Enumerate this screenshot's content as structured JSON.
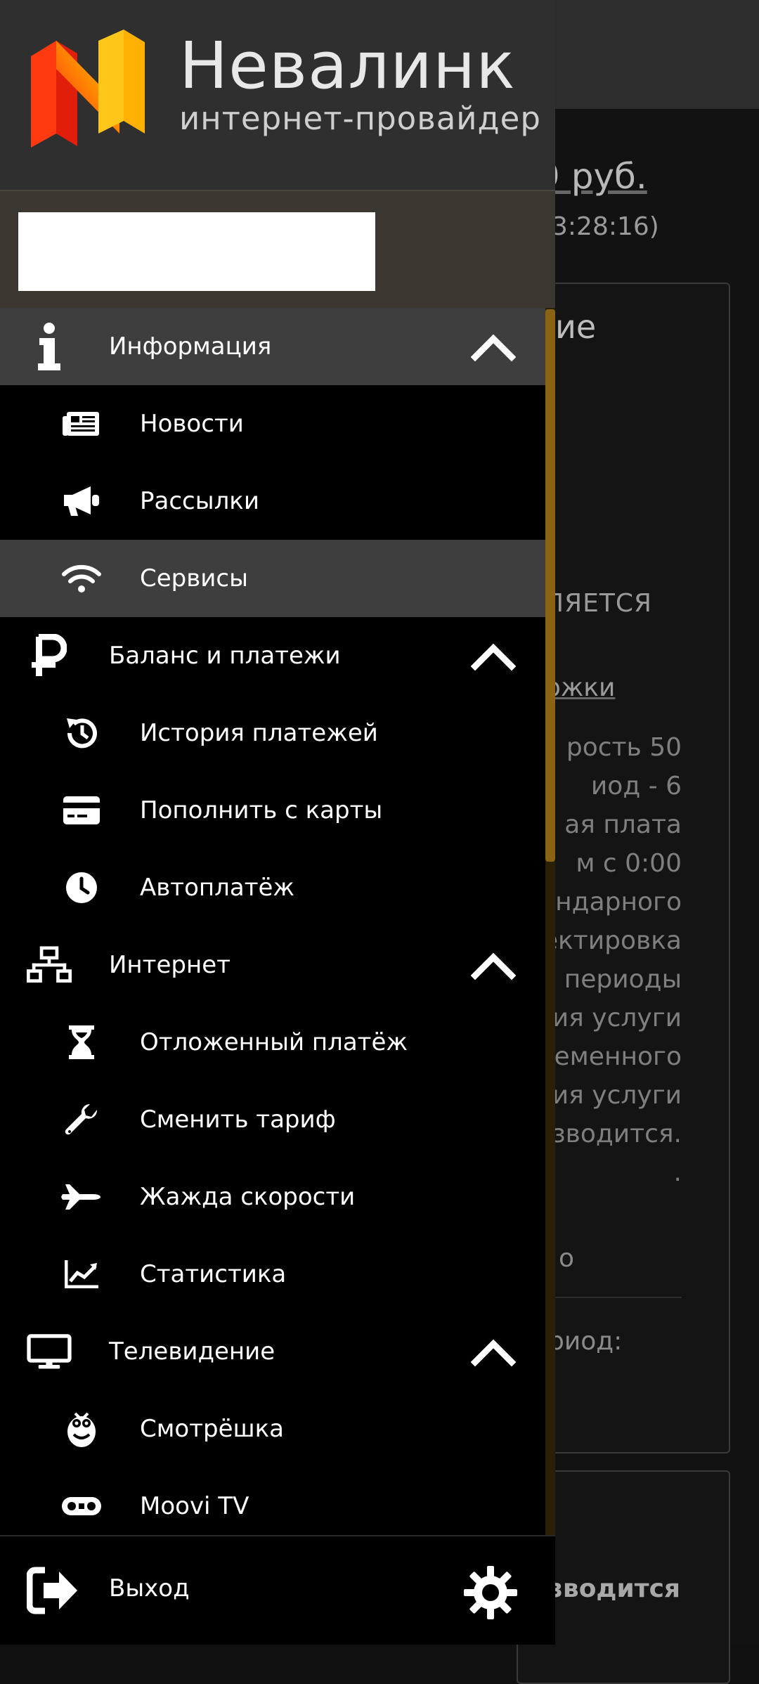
{
  "background": {
    "balance": "9 руб.",
    "time": "3:28:16)",
    "card_title": "ие",
    "status_upper": "ЛЯЕТСЯ",
    "link": "ржки",
    "paragraph": [
      "рость 50",
      "иод - 6",
      "ая плата",
      "м с 0:00",
      "ендарного",
      "ектировка",
      "периоды",
      "ия услуги",
      "еменного",
      "ия услуги",
      "зводится.",
      "."
    ],
    "small": "о",
    "period": "риод:",
    "bottom": "зводится"
  },
  "header": {
    "brand": "Невалинк",
    "tagline": "интернет-провайдер",
    "logo_colors": [
      "#ff2a1a",
      "#ff8c00",
      "#ffd21a"
    ]
  },
  "menu": [
    {
      "type": "section",
      "label": "Информация",
      "icon": "info-icon",
      "active": true,
      "expanded": true
    },
    {
      "type": "sub",
      "label": "Новости",
      "icon": "newspaper-icon"
    },
    {
      "type": "sub",
      "label": "Рассылки",
      "icon": "megaphone-icon"
    },
    {
      "type": "sub",
      "label": "Сервисы",
      "icon": "wifi-icon",
      "active": true
    },
    {
      "type": "section",
      "label": "Баланс и платежи",
      "icon": "ruble-icon",
      "expanded": true
    },
    {
      "type": "sub",
      "label": "История платежей",
      "icon": "history-icon"
    },
    {
      "type": "sub",
      "label": "Пополнить с карты",
      "icon": "credit-card-icon"
    },
    {
      "type": "sub",
      "label": "Автоплатёж",
      "icon": "clock-icon"
    },
    {
      "type": "section",
      "label": "Интернет",
      "icon": "network-icon",
      "expanded": true
    },
    {
      "type": "sub",
      "label": "Отложенный платёж",
      "icon": "hourglass-icon"
    },
    {
      "type": "sub",
      "label": "Сменить тариф",
      "icon": "wrench-icon"
    },
    {
      "type": "sub",
      "label": "Жажда скорости",
      "icon": "jet-icon"
    },
    {
      "type": "sub",
      "label": "Статистика",
      "icon": "chart-icon"
    },
    {
      "type": "section",
      "label": "Телевидение",
      "icon": "monitor-icon",
      "expanded": true
    },
    {
      "type": "sub",
      "label": "Смотрёшка",
      "icon": "smotreshka-icon"
    },
    {
      "type": "sub",
      "label": "Moovi TV",
      "icon": "moovi-icon"
    }
  ],
  "footer": {
    "logout_label": "Выход",
    "logout_icon": "logout-icon",
    "settings_icon": "gear-icon"
  },
  "colors": {
    "drawer_bg": "#000000",
    "active_row": "#3e3e3e",
    "user_panel": "#3b3730",
    "scrollbar": "#8a6414"
  }
}
